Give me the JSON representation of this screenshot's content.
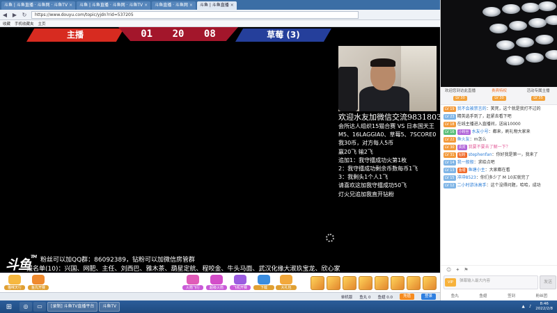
{
  "browser": {
    "tabs": [
      {
        "label": "斗鱼 | 斗鱼直播 · 斗鱼网 · 斗鱼TV",
        "active": false
      },
      {
        "label": "斗鱼 | 斗鱼直播 · 斗鱼网 · 斗鱼TV",
        "active": false
      },
      {
        "label": "斗鱼直播 · 斗鱼网",
        "active": false
      },
      {
        "label": "斗鱼 | 斗鱼直播",
        "active": true
      }
    ],
    "url": "https://www.douyu.com/topic/yjdn?rid=537205",
    "bookmarks": [
      "收藏",
      "手机收藏夹",
      "主页"
    ]
  },
  "banner": {
    "left_team": "主播",
    "right_team": "草莓 (3)",
    "timer": [
      "01",
      "20",
      "08"
    ]
  },
  "notice": {
    "headline": "欢迎水友加微信交流9831803",
    "lines": [
      "会所达人组织15猫合赛 VS 日本国天王",
      "M5、16LAGGIA0、草莓5、7SCORE0",
      "我30币，对方每人5币",
      "赢20飞 输2飞",
      "追加1：我守擂成功火第1枚",
      "2：我守擂成功剩余币数每币1飞",
      "3：我剩头1个人1飞",
      "请喜欢这加我守擂成功50飞",
      "灯火兄追加我直开钻粉"
    ]
  },
  "logo": {
    "text": "斗鱼",
    "tm": "TM"
  },
  "ticker": {
    "line1": "粉丝可以加QQ群：86092389，钻粉可以加微信房管群",
    "line2": "报名单(10)：兴国、网肥、主任、刘西巴、雅木茶、葫星定航、程咬金、牛头马面、武汉化缘大淑玖宝龙、欣心家"
  },
  "gifts": [
    {
      "label": "猫咪天行",
      "color": "#f6b840",
      "p": false
    },
    {
      "label": "鱼丸开赛",
      "color": "#ef8a2f",
      "p": false
    },
    {
      "label": "火箭飞行",
      "color": "#e05bb8",
      "p": true
    },
    {
      "label": "超级火箭",
      "color": "#d34ec9",
      "p": true
    },
    {
      "label": "飞机开赛",
      "color": "#9b5ce0",
      "p": true
    },
    {
      "label": "下载",
      "color": "#3a8de0",
      "p": false
    },
    {
      "label": "大礼包",
      "color": "#f2a83b",
      "p": false
    }
  ],
  "statusbar": {
    "items": [
      "单机版",
      "鱼丸 0",
      "鱼翅 0.0"
    ],
    "charge": "充值",
    "login": "登录"
  },
  "taskbar": {
    "items": [
      "[录制] 斗鱼TV直播平台",
      "斗鱼TV"
    ],
    "time": "8:46",
    "date": "2022/2/8"
  },
  "side": {
    "tabs": [
      {
        "label": "欢迎您到访此直播",
        "level": "LV 30",
        "active": false
      },
      {
        "label": "贵宾特权",
        "level": "LV 30",
        "active": true
      },
      {
        "label": "活动专属主播",
        "level": "LV 35",
        "active": false
      }
    ],
    "chat": [
      {
        "lv": "LV 19",
        "lvc": "o",
        "badge": "",
        "nick": "我不会被禁言的",
        "text": "：笑死，这个就是我打不过的"
      },
      {
        "lv": "LV 23",
        "lvc": "",
        "badge": "",
        "nick": "",
        "text": "精英选手到了，赶紧去看下吧"
      },
      {
        "lv": "LV 18",
        "lvc": "o",
        "badge": "",
        "nick": "",
        "text": "在线主播进入直播间，送出10000"
      },
      {
        "lv": "LV 16",
        "lvc": "g",
        "badge": "小粉丝",
        "nick": "水友小号",
        "text": "：都来，刷礼物大家来"
      },
      {
        "lv": "LV 22",
        "lvc": "o",
        "badge": "",
        "nick": "鱼火友",
        "text": "：m怎么"
      },
      {
        "lv": "LV 30",
        "lvc": "o",
        "badge": "贵宾",
        "nick": "",
        "text": "我要不要去了解一下？"
      },
      {
        "lv": "LV 31",
        "lvc": "o",
        "badge": "钻粉",
        "nick": "stephenfan",
        "text": "：你好我是第一，我来了"
      },
      {
        "lv": "LV 14",
        "lvc": "",
        "badge": "",
        "nick": "我一般般",
        "text": "：求给点吧"
      },
      {
        "lv": "LV 13",
        "lvc": "",
        "badge": "鱼塘",
        "nick": "鱼塘小主",
        "text": "：大家都在看"
      },
      {
        "lv": "LV 15",
        "lvc": "",
        "badge": "",
        "nick": "冲冲8523",
        "text": "：你们多少了 M 10买就完了"
      },
      {
        "lv": "LV 12",
        "lvc": "",
        "badge": "",
        "nick": "二小时游泳高手",
        "text": "：这个没得问题，哈哈，成功"
      }
    ],
    "input_placeholder": "弹幕输入最大内容",
    "input_icon": "VIP",
    "send": "发送",
    "foot": [
      "鱼丸",
      "鱼翅",
      "签到",
      "粉丝团"
    ]
  },
  "colors": {
    "left_team": "#d72b20",
    "right_team": "#253f9b",
    "timer_bg": "#a3162b",
    "accent": "#f26b1d"
  }
}
